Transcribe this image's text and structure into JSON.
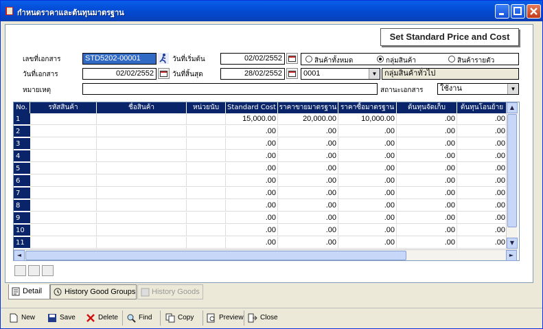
{
  "window": {
    "title": "กำหนดราคาและต้นทุนมาตรฐาน"
  },
  "banner": {
    "label": "Set Standard Price and Cost"
  },
  "form": {
    "doc_no_label": "เลขที่เอกสาร",
    "doc_no": "STD5202-00001",
    "start_date_label": "วันที่เริ่มต้น",
    "start_date": "02/02/2552",
    "doc_date_label": "วันที่เอกสาร",
    "doc_date": "02/02/2552",
    "end_date_label": "วันที่สิ้นสุด",
    "end_date": "28/02/2552",
    "remark_label": "หมายเหตุ",
    "remark": "",
    "radio_all": "สินค้าทั้งหมด",
    "radio_group": "กลุ่มสินค้า",
    "radio_item": "สินค้ารายตัว",
    "group_code": "0001",
    "group_name": "กลุ่มสินค้าทั่วไป",
    "status_label": "สถานะเอกสาร",
    "status": "ใช้งาน"
  },
  "grid": {
    "columns": [
      "No.",
      "รหัสสินค้า",
      "ชื่อสินค้า",
      "หน่วยนับ",
      "Standard Cost",
      "ราคาขายมาตรฐาน",
      "ราคาซื้อมาตรฐาน",
      "ต้นทุนจัดเก็บ",
      "ต้นทุนโอนย้าย"
    ],
    "rows": [
      [
        "1",
        "",
        "",
        "",
        "15,000.00",
        "20,000.00",
        "10,000.00",
        ".00",
        ".00"
      ],
      [
        "2",
        "",
        "",
        "",
        ".00",
        ".00",
        ".00",
        ".00",
        ".00"
      ],
      [
        "3",
        "",
        "",
        "",
        ".00",
        ".00",
        ".00",
        ".00",
        ".00"
      ],
      [
        "4",
        "",
        "",
        "",
        ".00",
        ".00",
        ".00",
        ".00",
        ".00"
      ],
      [
        "5",
        "",
        "",
        "",
        ".00",
        ".00",
        ".00",
        ".00",
        ".00"
      ],
      [
        "6",
        "",
        "",
        "",
        ".00",
        ".00",
        ".00",
        ".00",
        ".00"
      ],
      [
        "7",
        "",
        "",
        "",
        ".00",
        ".00",
        ".00",
        ".00",
        ".00"
      ],
      [
        "8",
        "",
        "",
        "",
        ".00",
        ".00",
        ".00",
        ".00",
        ".00"
      ],
      [
        "9",
        "",
        "",
        "",
        ".00",
        ".00",
        ".00",
        ".00",
        ".00"
      ],
      [
        "10",
        "",
        "",
        "",
        ".00",
        ".00",
        ".00",
        ".00",
        ".00"
      ],
      [
        "11",
        "",
        "",
        "",
        ".00",
        ".00",
        ".00",
        ".00",
        ".00"
      ]
    ]
  },
  "tabs": {
    "detail": "Detail",
    "history_groups": "History Good Groups",
    "history_goods": "History Goods"
  },
  "toolbar": {
    "new": "New",
    "save": "Save",
    "delete": "Delete",
    "find": "Find",
    "copy": "Copy",
    "preview": "Preview",
    "close": "Close"
  }
}
